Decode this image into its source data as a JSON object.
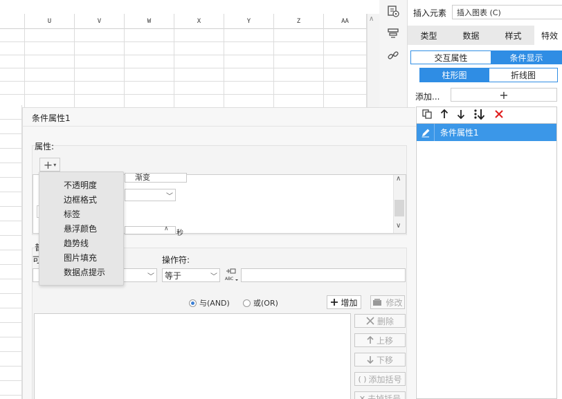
{
  "sheet": {
    "columns": [
      "U",
      "V",
      "W",
      "X",
      "Y",
      "Z",
      "AA"
    ]
  },
  "right_panel": {
    "insert_label": "插入元素",
    "insert_select": "插入图表 (C)",
    "tabs": [
      "类型",
      "数据",
      "样式",
      "特效"
    ],
    "sub_tabs": [
      "交互属性",
      "条件显示"
    ],
    "chart_tabs": [
      "柱形图",
      "折线图"
    ],
    "add_label": "添加...",
    "add_symbol": "+",
    "list_item": "条件属性1"
  },
  "dialog": {
    "title": "条件属性1",
    "attributes_label": "属性:",
    "add_attr_symbol": "+",
    "hidden_text": "渐变",
    "hidden_unit": "秒",
    "operator_label": "操作符:",
    "operator_value": "等于",
    "and_label": "与(AND)",
    "or_label": "或(OR)",
    "add_button": "增加",
    "modify_button": "修改",
    "delete_button": "删除",
    "up_button": "上移",
    "down_button": "下移",
    "add_bracket_button": "添加括号",
    "remove_bracket_button": "去掉括号",
    "peek_label_1": "普",
    "peek_label_2": "可"
  },
  "popup": {
    "items": [
      "不透明度",
      "边框格式",
      "标签",
      "悬浮颜色",
      "趋势线",
      "图片填充",
      "数据点提示"
    ]
  },
  "colors": {
    "accent": "#2f8de4",
    "selected_item": "#3b97e8",
    "delete_red": "#e02020"
  }
}
